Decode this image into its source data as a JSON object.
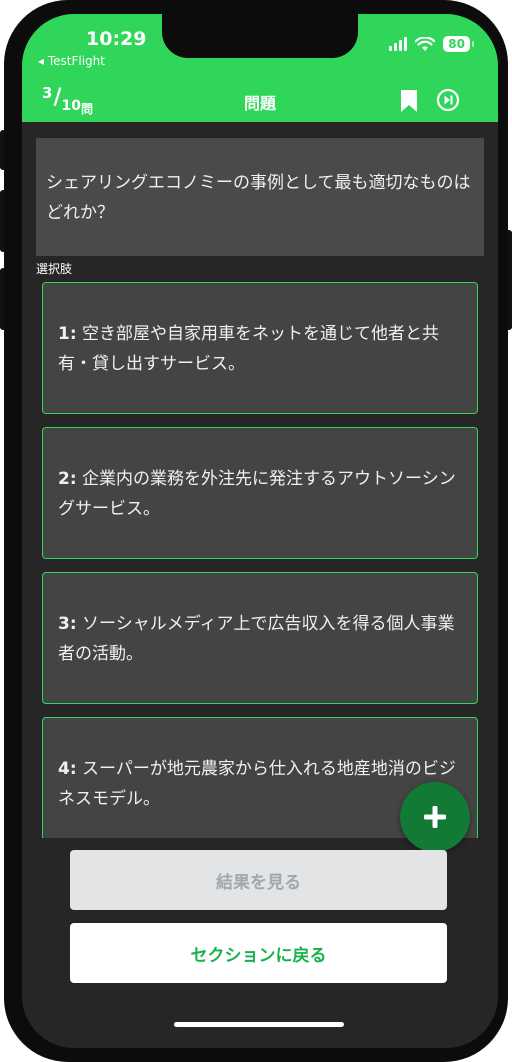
{
  "status": {
    "time": "10:29",
    "back_app": "◂ TestFlight",
    "battery": "80"
  },
  "header": {
    "current": "3",
    "slash": "/",
    "total": "10",
    "unit": "問",
    "title": "問題",
    "bookmark_icon": "bookmark-icon",
    "skip_icon": "skip-forward-circle-icon"
  },
  "question": {
    "text": "シェアリングエコノミーの事例として最も適切なものはどれか？"
  },
  "choices_label": "選択肢",
  "choices": [
    {
      "number": "1:",
      "text": "空き部屋や自家用車をネットを通じて他者と共有・貸し出すサービス。"
    },
    {
      "number": "2:",
      "text": "企業内の業務を外注先に発注するアウトソーシングサービス。"
    },
    {
      "number": "3:",
      "text": "ソーシャルメディア上で広告収入を得る個人事業者の活動。"
    },
    {
      "number": "4:",
      "text": "スーパーが地元農家から仕入れる地産地消のビジネスモデル。"
    }
  ],
  "buttons": {
    "results": "結果を見る",
    "back_to_section": "セクションに戻る",
    "fab_icon": "plus-icon"
  },
  "colors": {
    "accent": "#2fd65a",
    "fab": "#137a35",
    "background": "#262626"
  }
}
